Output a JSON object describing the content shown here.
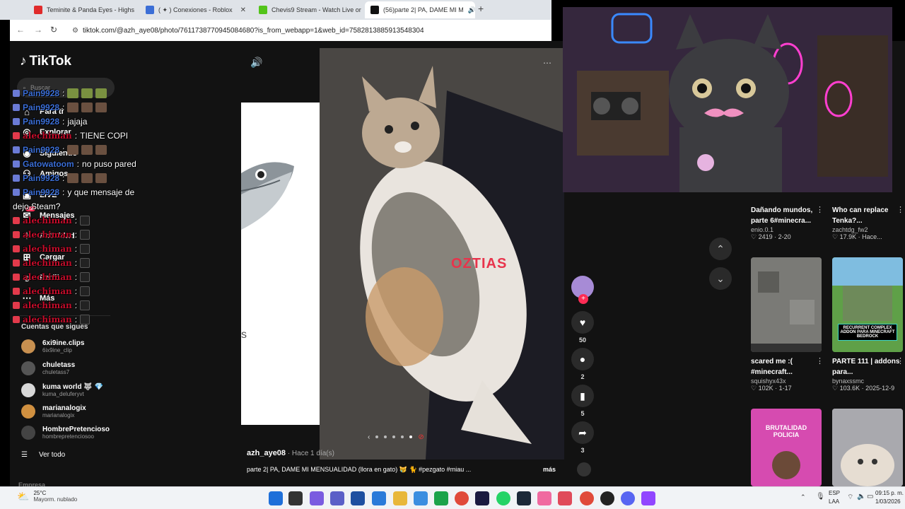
{
  "browser": {
    "tabs": [
      {
        "title": "Teminite & Panda Eyes - Highs",
        "color": "#e02b2b"
      },
      {
        "title": "( ✦ ) Conexiones - Roblox",
        "color": "#3b6ed6"
      },
      {
        "title": "Chevis9 Stream - Watch Live or",
        "color": "#53c41a"
      },
      {
        "title": "(56)parte 2| PA, DAME MI M",
        "color": "#111111"
      }
    ],
    "new_tab": "+",
    "url": "tiktok.com/@azh_aye08/photo/7611738770945084680?is_from_webapp=1&web_id=7582813885913548304"
  },
  "tiktok": {
    "logo": "TikTok",
    "search_placeholder": "Buscar",
    "nav": [
      "Para ti",
      "Explorar",
      "Siguiendo",
      "Amigos",
      "LIVE",
      "Mensajes",
      "Actividad",
      "Cargar",
      "Perfil",
      "Más"
    ],
    "messages_badge": "22",
    "following_title": "Cuentas que sigues",
    "following": [
      {
        "name": "6xi9ine.clips",
        "handle": "6ix9ine_clip",
        "color": "#c89050"
      },
      {
        "name": "chuletass",
        "handle": "chuletass7",
        "color": "#555555"
      },
      {
        "name": "kuma world 🐺 💎",
        "handle": "kuma_deluferyvt",
        "color": "#d8d8d8"
      },
      {
        "name": "marianalogix",
        "handle": "marianalogix",
        "color": "#d09040"
      },
      {
        "name": "HombrePretencioso",
        "handle": "hombrepretenciosoo",
        "color": "#444444"
      }
    ],
    "see_all": "Ver todo",
    "empresa": "Empresa"
  },
  "chat": [
    {
      "user": "Pain9928",
      "style": "u1",
      "text": "",
      "emotes": [
        "g",
        "g",
        "g"
      ]
    },
    {
      "user": "Pain9928",
      "style": "u1",
      "text": "",
      "emotes": [
        "b",
        "b",
        "b"
      ]
    },
    {
      "user": "Pain9928",
      "style": "u1",
      "text": "jajaja",
      "emotes": []
    },
    {
      "user": "alechiman",
      "style": "u2",
      "text": "TIENE COPI",
      "emotes": []
    },
    {
      "user": "Pain9928",
      "style": "u1",
      "text": "",
      "emotes": [
        "b",
        "b",
        "b"
      ]
    },
    {
      "user": "Gatowatoom",
      "style": "u3",
      "text": "no puso pared",
      "emotes": []
    },
    {
      "user": "Pain9928",
      "style": "u1",
      "text": "",
      "emotes": [
        "b",
        "b",
        "b"
      ]
    },
    {
      "user": "Pain9928",
      "style": "u1",
      "text": "y que mensaje de",
      "emotes": []
    },
    {
      "user": "",
      "style": "",
      "text": "dejo Steam?",
      "emotes": []
    },
    {
      "user": "alechiman",
      "style": "u2",
      "text": "",
      "emotes": [
        "s"
      ]
    },
    {
      "user": "alechiman",
      "style": "u2",
      "text": "",
      "emotes": [
        "s"
      ]
    },
    {
      "user": "alechiman",
      "style": "u2",
      "text": "",
      "emotes": [
        "s"
      ]
    },
    {
      "user": "alechiman",
      "style": "u2",
      "text": "",
      "emotes": [
        "s"
      ]
    },
    {
      "user": "alechiman",
      "style": "u2",
      "text": "",
      "emotes": [
        "s"
      ]
    },
    {
      "user": "alechiman",
      "style": "u2",
      "text": "",
      "emotes": [
        "s"
      ]
    },
    {
      "user": "alechiman",
      "style": "u2",
      "text": "",
      "emotes": [
        "s"
      ]
    },
    {
      "user": "alechiman",
      "style": "u2",
      "text": "",
      "emotes": [
        "s"
      ]
    }
  ],
  "post": {
    "overlay_text": "OZTIAS",
    "author": "azh_aye08",
    "time": " · Hace 1 día(s)",
    "caption": "parte 2| PA, DAME MI MENSUALIDAD (llora en gato) 😿 🐈 #pezgato #miau ...",
    "more": "más",
    "likes": "50",
    "comments": "2",
    "saves": "5",
    "shares": "3"
  },
  "related": [
    {
      "title": "Dañando mundos, parte 6#minecra...",
      "author": "enio.0.1",
      "views": "2419",
      "date": "2-20"
    },
    {
      "title": "Who can replace Tenka?...",
      "author": "zachtdg_fw2",
      "views": "17.9K",
      "date": "Hace..."
    },
    {
      "title": "scared me :( #minecraft...",
      "author": "squishyx43x",
      "views": "102K",
      "date": "1-17"
    },
    {
      "title": "PARTE 111 | addons para...",
      "author": "bynaxssmc",
      "views": "103.6K",
      "date": "2025-12-9"
    }
  ],
  "thumb_text": {
    "addon": "RECURRENT COMPLEX ADDON PARA MINECRAFT BEDROCK",
    "brutalidad": "BRUTALIDAD POLICIA"
  },
  "taskbar": {
    "temp": "25°C",
    "weather": "Mayorm. nublado",
    "lang1": "ESP",
    "lang2": "LAA",
    "time": "09:15 p. m.",
    "date": "1/03/2026"
  }
}
